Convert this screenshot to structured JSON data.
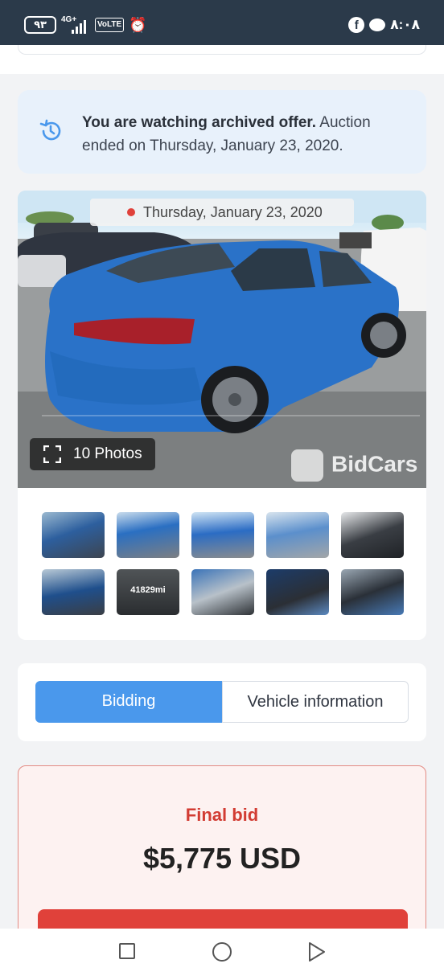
{
  "status_bar": {
    "battery": "٩٣",
    "network": "4G+",
    "volte": "VoLTE",
    "alarm_icon": "alarm-icon",
    "facebook_icon": "f",
    "time": "٨:٠٨"
  },
  "banner": {
    "bold_text": "You are watching archived offer.",
    "text": " Auction ended on Thursday, January 23, 2020.",
    "icon": "history-icon"
  },
  "gallery": {
    "date": "Thursday, January 23, 2020",
    "photos_button": "10 Photos",
    "watermark": "BidCars",
    "thumbnails": [
      {
        "label": ""
      },
      {
        "label": ""
      },
      {
        "label": ""
      },
      {
        "label": ""
      },
      {
        "label": ""
      },
      {
        "label": ""
      },
      {
        "label": "41829mi"
      },
      {
        "label": ""
      },
      {
        "label": ""
      },
      {
        "label": ""
      }
    ]
  },
  "tabs": {
    "bidding": "Bidding",
    "vehicle_info": "Vehicle information",
    "active": "bidding"
  },
  "final_bid": {
    "label": "Final bid",
    "value": "$5,775 USD"
  },
  "colors": {
    "accent_blue": "#4a98ec",
    "bid_red": "#d23c33",
    "banner_bg": "#e8f1fb",
    "car_blue": "#2a72c8"
  }
}
